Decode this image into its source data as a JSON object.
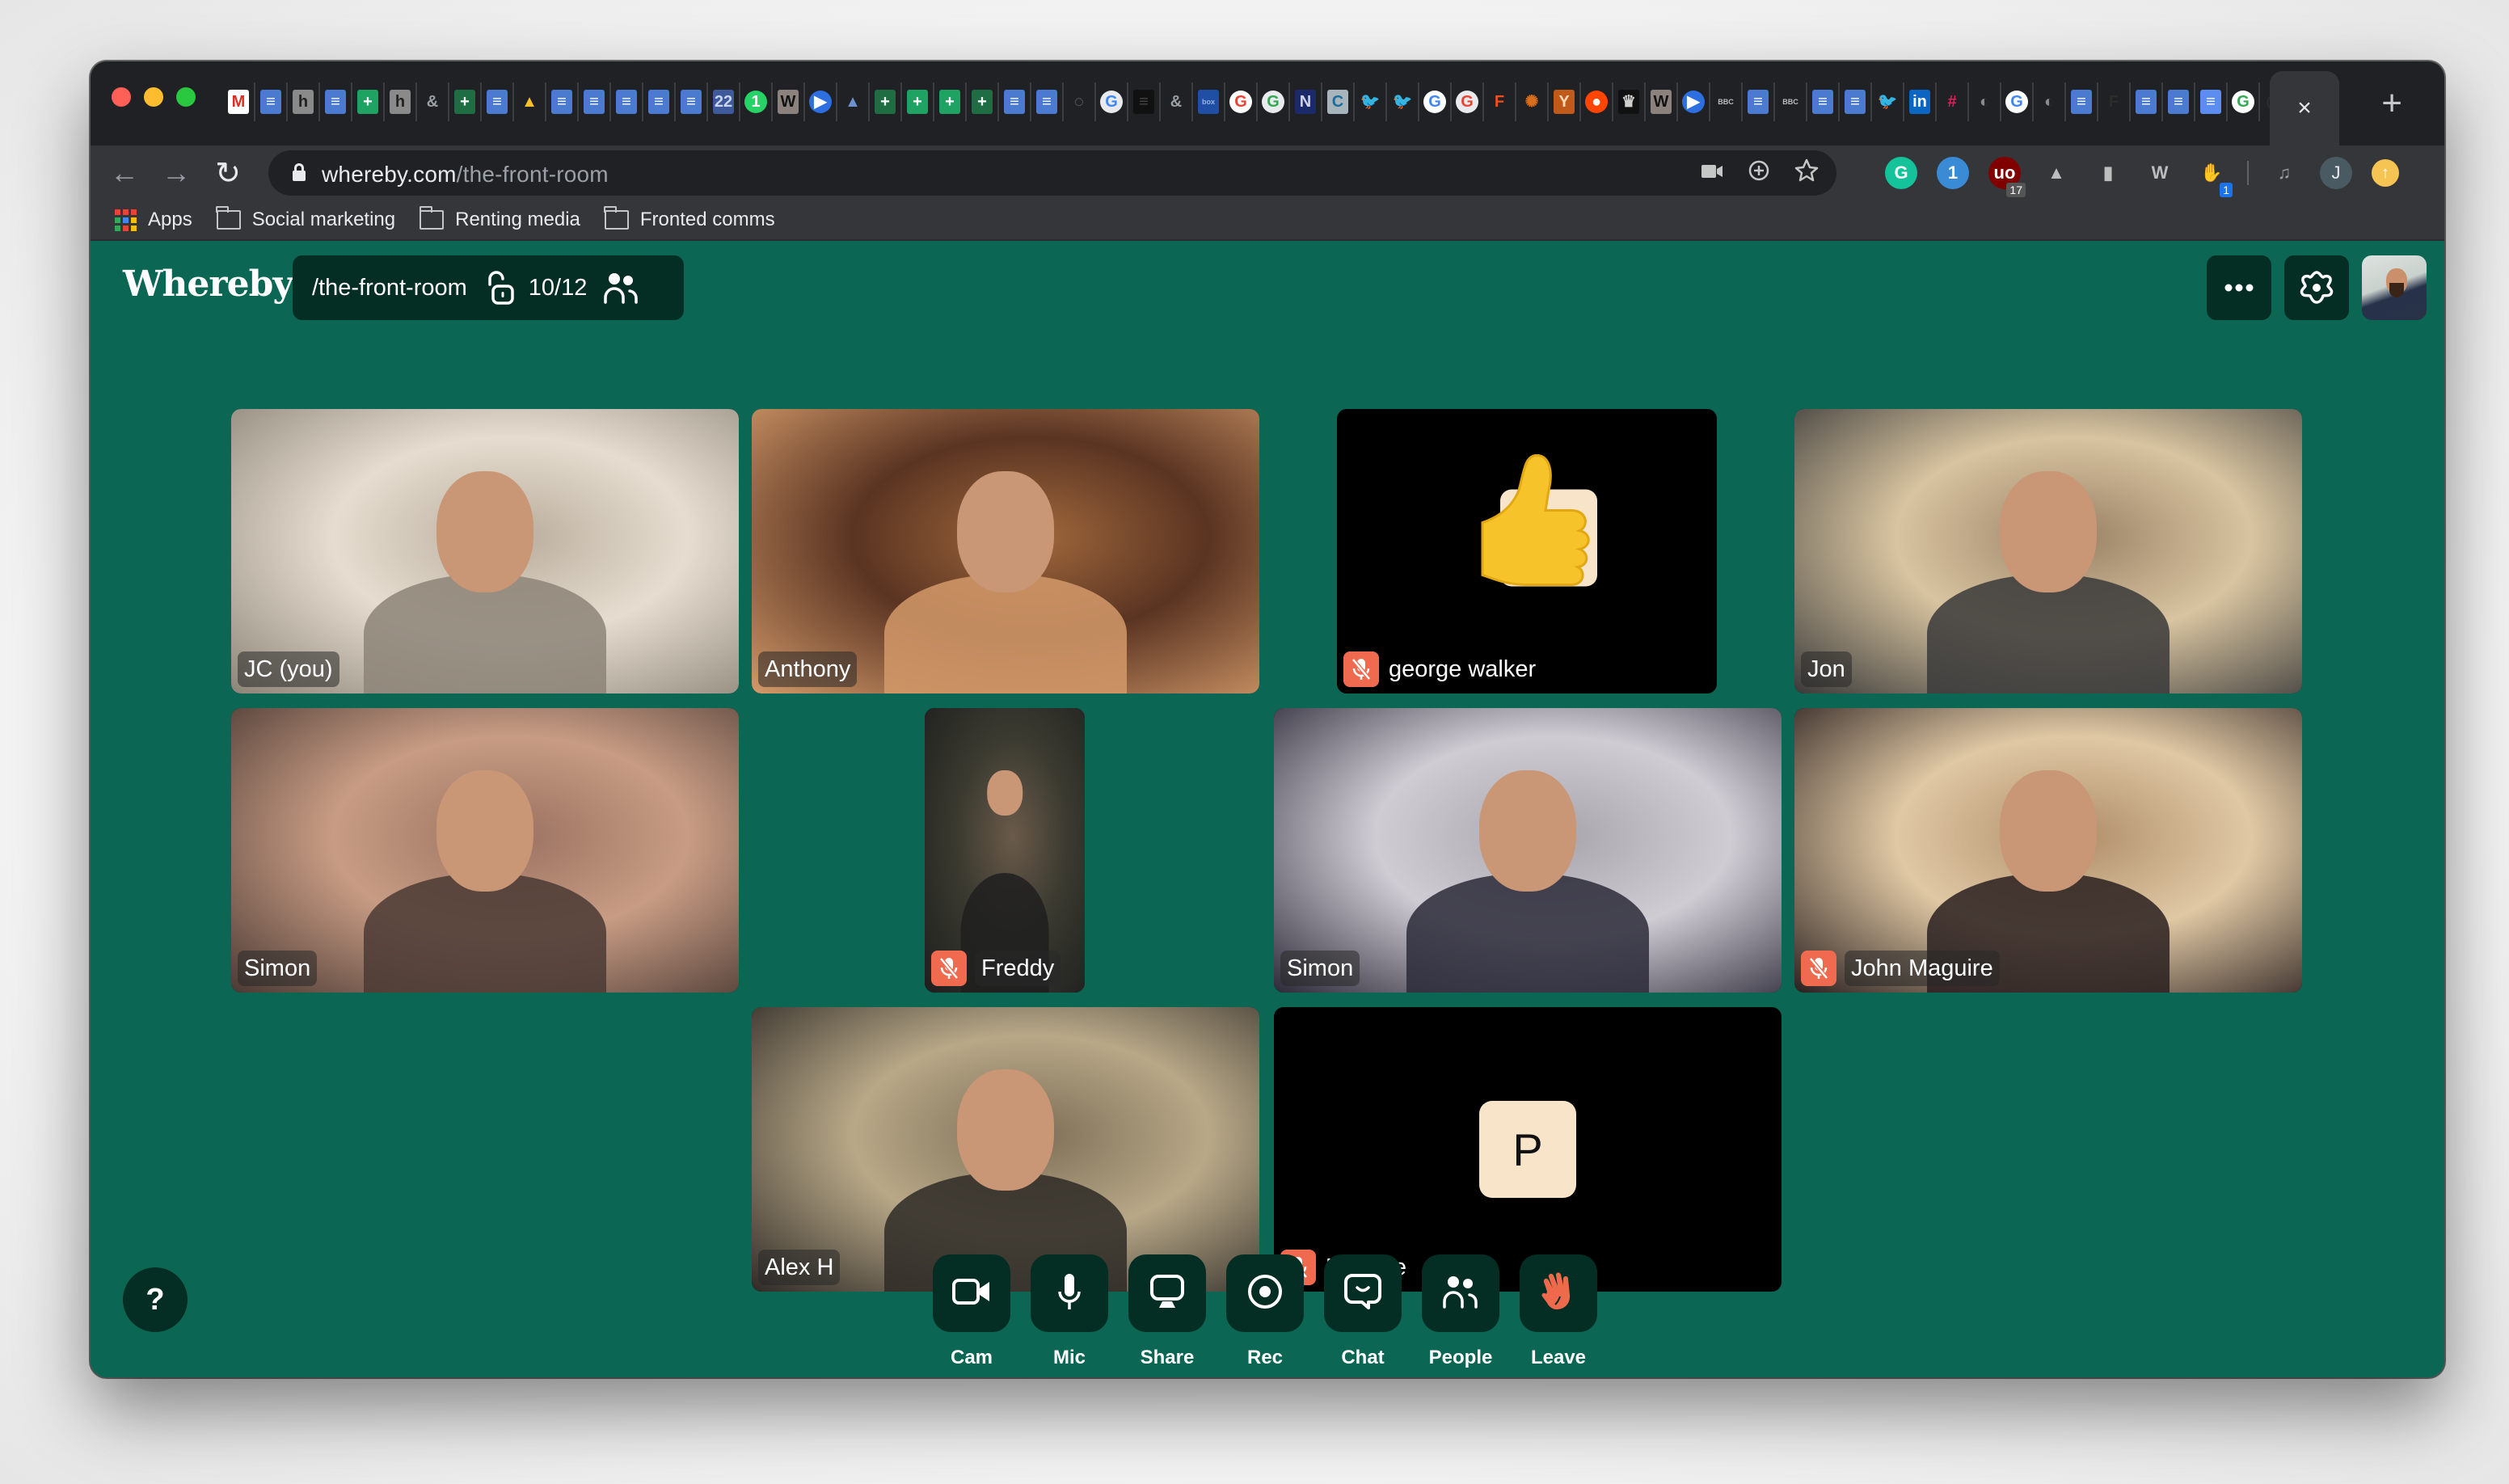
{
  "browser": {
    "window_controls": [
      "close",
      "minimize",
      "maximize"
    ],
    "tabs": [
      {
        "icon": "gmail-icon",
        "glyph": "M",
        "bg": "#ffffff",
        "fg": "#d93025"
      },
      {
        "icon": "google-docs-icon",
        "glyph": "≡",
        "bg": "#4a7bd0",
        "fg": "#ffffff"
      },
      {
        "icon": "h-icon",
        "glyph": "h",
        "bg": "#8a8a8a",
        "fg": "#222222"
      },
      {
        "icon": "google-docs-icon",
        "glyph": "≡",
        "bg": "#4a7bd0",
        "fg": "#ffffff"
      },
      {
        "icon": "google-sheets-icon",
        "glyph": "+",
        "bg": "#1ea362",
        "fg": "#ffffff"
      },
      {
        "icon": "h-icon",
        "glyph": "h",
        "bg": "#8a8a8a",
        "fg": "#222222"
      },
      {
        "icon": "key-icon",
        "glyph": "&",
        "bg": "#202124",
        "fg": "#9aa0a6"
      },
      {
        "icon": "google-sheets-icon",
        "glyph": "+",
        "bg": "#1f6e43",
        "fg": "#ffffff"
      },
      {
        "icon": "google-docs-icon",
        "glyph": "≡",
        "bg": "#4a7bd0",
        "fg": "#ffffff"
      },
      {
        "icon": "google-drive-icon",
        "glyph": "▲",
        "bg": "#202124",
        "fg": "#f6c026"
      },
      {
        "icon": "google-docs-icon",
        "glyph": "≡",
        "bg": "#4a7bd0",
        "fg": "#ffffff"
      },
      {
        "icon": "google-docs-icon",
        "glyph": "≡",
        "bg": "#4a7bd0",
        "fg": "#ffffff"
      },
      {
        "icon": "google-docs-icon",
        "glyph": "≡",
        "bg": "#4a7bd0",
        "fg": "#ffffff"
      },
      {
        "icon": "google-docs-icon",
        "glyph": "≡",
        "bg": "#4a7bd0",
        "fg": "#ffffff"
      },
      {
        "icon": "google-docs-icon",
        "glyph": "≡",
        "bg": "#4a7bd0",
        "fg": "#ffffff"
      },
      {
        "icon": "calendar-icon",
        "glyph": "22",
        "bg": "#3e5a9a",
        "fg": "#c8d4f0"
      },
      {
        "icon": "whatsapp-icon",
        "glyph": "1",
        "bg": "#25d366",
        "fg": "#ffffff",
        "round": true
      },
      {
        "icon": "wikipedia-icon",
        "glyph": "W",
        "bg": "#8c827d",
        "fg": "#111111"
      },
      {
        "icon": "zoom-icon",
        "glyph": "▶",
        "bg": "#2d6ee0",
        "fg": "#ffffff",
        "round": true
      },
      {
        "icon": "google-drive-icon",
        "glyph": "▲",
        "bg": "#202124",
        "fg": "#6e8fd1"
      },
      {
        "icon": "google-sheets-icon",
        "glyph": "+",
        "bg": "#1f6e43",
        "fg": "#ffffff"
      },
      {
        "icon": "google-sheets-icon",
        "glyph": "+",
        "bg": "#1ea362",
        "fg": "#ffffff"
      },
      {
        "icon": "google-sheets-icon",
        "glyph": "+",
        "bg": "#1ea362",
        "fg": "#ffffff"
      },
      {
        "icon": "google-sheets-icon",
        "glyph": "+",
        "bg": "#1f6e43",
        "fg": "#ffffff"
      },
      {
        "icon": "google-docs-icon",
        "glyph": "≡",
        "bg": "#4a7bd0",
        "fg": "#ffffff"
      },
      {
        "icon": "google-docs-icon",
        "glyph": "≡",
        "bg": "#4a7bd0",
        "fg": "#ffffff"
      },
      {
        "icon": "loop-icon",
        "glyph": "◌",
        "bg": "#202124",
        "fg": "#8a8a8a"
      },
      {
        "icon": "google-icon",
        "glyph": "G",
        "bg": "#e8eaed",
        "fg": "#4285f4",
        "round": true
      },
      {
        "icon": "menu-icon",
        "glyph": "≡",
        "bg": "#111111",
        "fg": "#444444"
      },
      {
        "icon": "key-icon",
        "glyph": "&",
        "bg": "#202124",
        "fg": "#9aa0a6"
      },
      {
        "icon": "box-icon",
        "glyph": "box",
        "bg": "#1f4fa5",
        "fg": "#9ab4e8"
      },
      {
        "icon": "google-icon",
        "glyph": "G",
        "bg": "#ffffff",
        "fg": "#ea4335",
        "round": true
      },
      {
        "icon": "google-icon",
        "glyph": "G",
        "bg": "#e8eaed",
        "fg": "#34a853",
        "round": true
      },
      {
        "icon": "notion-icon",
        "glyph": "N",
        "bg": "#1b2a6b",
        "fg": "#d0d4e8"
      },
      {
        "icon": "c-icon",
        "glyph": "C",
        "bg": "#a8b4bc",
        "fg": "#1a6e9a"
      },
      {
        "icon": "twitter-icon",
        "glyph": "🐦",
        "bg": "#202124",
        "fg": "#1d9bf0"
      },
      {
        "icon": "twitter-icon",
        "glyph": "🐦",
        "bg": "#202124",
        "fg": "#1d9bf0"
      },
      {
        "icon": "google-icon",
        "glyph": "G",
        "bg": "#ffffff",
        "fg": "#4285f4",
        "round": true
      },
      {
        "icon": "google-icon",
        "glyph": "G",
        "bg": "#e8eaed",
        "fg": "#ea4335",
        "round": true
      },
      {
        "icon": "figma-icon",
        "glyph": "F",
        "bg": "#202124",
        "fg": "#f24e1e"
      },
      {
        "icon": "sunflower-icon",
        "glyph": "✺",
        "bg": "#202124",
        "fg": "#d86f1c"
      },
      {
        "icon": "y-combinator-icon",
        "glyph": "Y",
        "bg": "#c05a1a",
        "fg": "#ffd8b8"
      },
      {
        "icon": "reddit-icon",
        "glyph": "●",
        "bg": "#ff4500",
        "fg": "#ffffff",
        "round": true
      },
      {
        "icon": "crown-icon",
        "glyph": "♛",
        "bg": "#111111",
        "fg": "#d0d0d0"
      },
      {
        "icon": "wikipedia-icon",
        "glyph": "W",
        "bg": "#8c827d",
        "fg": "#111111"
      },
      {
        "icon": "zoom-icon",
        "glyph": "▶",
        "bg": "#2d6ee0",
        "fg": "#ffffff",
        "round": true
      },
      {
        "icon": "bbc-icon",
        "glyph": "BBC",
        "bg": "#202124",
        "fg": "#bdbdbd"
      },
      {
        "icon": "google-docs-icon",
        "glyph": "≡",
        "bg": "#4a7bd0",
        "fg": "#ffffff"
      },
      {
        "icon": "bbc-icon",
        "glyph": "BBC",
        "bg": "#202124",
        "fg": "#bdbdbd"
      },
      {
        "icon": "google-docs-icon",
        "glyph": "≡",
        "bg": "#4a7bd0",
        "fg": "#ffffff"
      },
      {
        "icon": "google-docs-icon",
        "glyph": "≡",
        "bg": "#4a7bd0",
        "fg": "#ffffff"
      },
      {
        "icon": "twitter-icon",
        "glyph": "🐦",
        "bg": "#202124",
        "fg": "#1d9bf0"
      },
      {
        "icon": "linkedin-icon",
        "glyph": "in",
        "bg": "#0a66c2",
        "fg": "#ffffff"
      },
      {
        "icon": "slack-icon",
        "glyph": "#",
        "bg": "#202124",
        "fg": "#e01e5a"
      },
      {
        "icon": "globe-icon",
        "glyph": "◐",
        "bg": "#202124",
        "fg": "#8a8a8a"
      },
      {
        "icon": "google-icon",
        "glyph": "G",
        "bg": "#ffffff",
        "fg": "#4285f4",
        "round": true
      },
      {
        "icon": "globe-icon",
        "glyph": "◐",
        "bg": "#202124",
        "fg": "#8a8a8a"
      },
      {
        "icon": "google-docs-icon",
        "glyph": "≡",
        "bg": "#4a7bd0",
        "fg": "#ffffff"
      },
      {
        "icon": "f-icon",
        "glyph": "F",
        "bg": "#202124",
        "fg": "#2c2c2c"
      },
      {
        "icon": "google-docs-icon",
        "glyph": "≡",
        "bg": "#4a7bd0",
        "fg": "#ffffff"
      },
      {
        "icon": "google-docs-icon",
        "glyph": "≡",
        "bg": "#4a7bd0",
        "fg": "#ffffff"
      },
      {
        "icon": "google-docs-icon",
        "glyph": "≡",
        "bg": "#5b8ef0",
        "fg": "#ffffff"
      },
      {
        "icon": "google-icon",
        "glyph": "G",
        "bg": "#ffffff",
        "fg": "#34a853",
        "round": true
      },
      {
        "icon": "github-icon",
        "glyph": "◯",
        "bg": "#202124",
        "fg": "#2c2c2c"
      }
    ],
    "active_tab_close": "×",
    "new_tab": "+",
    "nav": {
      "back": "←",
      "forward": "→",
      "reload": "↻"
    },
    "address": {
      "host": "whereby.com",
      "path": "/the-front-room"
    },
    "omnibox_icons": [
      "camera-icon",
      "zoom-in-icon",
      "bookmark-star-icon"
    ],
    "extensions": [
      {
        "icon": "grammarly-icon",
        "glyph": "G",
        "bg": "#15c39a"
      },
      {
        "icon": "password-manager-icon",
        "glyph": "1",
        "bg": "#3a8bd6"
      },
      {
        "icon": "ublock-icon",
        "glyph": "uo",
        "bg": "#800000",
        "badge": "17",
        "badge_bg": "#555555"
      },
      {
        "icon": "drive-icon",
        "glyph": "▲",
        "bg": "#35363a"
      },
      {
        "icon": "battery-icon",
        "glyph": "▮",
        "bg": "#35363a"
      },
      {
        "icon": "wikipedia-icon",
        "glyph": "W",
        "bg": "#35363a"
      },
      {
        "icon": "wave-hand-icon",
        "glyph": "✋",
        "bg": "#35363a",
        "badge": "1",
        "badge_bg": "#1a73e8"
      }
    ],
    "media_control_icon": "♫",
    "profile_initial": "J",
    "update_icon": "↑",
    "bookmarks": [
      {
        "type": "apps",
        "label": "Apps"
      },
      {
        "type": "folder",
        "label": "Social marketing"
      },
      {
        "type": "folder",
        "label": "Renting media"
      },
      {
        "type": "folder",
        "label": "Fronted comms"
      }
    ]
  },
  "app": {
    "brand": "Whereby",
    "brand_color": "#0b6654",
    "dark_color": "#042d23",
    "mute_color": "#f06a50",
    "room": {
      "name": "/the-front-room",
      "occupancy": "10/12",
      "locked": false
    },
    "participants": [
      {
        "name": "JC (you)",
        "muted": false,
        "video": "camera",
        "bg": [
          "#e6ddd0",
          "#b9ad9c",
          "#8d8478"
        ]
      },
      {
        "name": "Anthony",
        "muted": false,
        "video": "camera",
        "bg": [
          "#5a3422",
          "#a0683c",
          "#d39a6a"
        ]
      },
      {
        "name": "george walker",
        "muted": true,
        "video": "emoji",
        "emoji": "👍"
      },
      {
        "name": "Jon",
        "muted": false,
        "video": "camera",
        "bg": [
          "#d8c4a0",
          "#9a8266",
          "#3a3a3a"
        ]
      },
      {
        "name": "Simon",
        "muted": false,
        "video": "camera",
        "bg": [
          "#c89c84",
          "#9a7260",
          "#4a3a34"
        ]
      },
      {
        "name": "Freddy",
        "muted": true,
        "video": "camera",
        "bg": [
          "#3a3a30",
          "#6a5a4a",
          "#1e1e1e"
        ]
      },
      {
        "name": "Simon",
        "muted": false,
        "video": "camera",
        "bg": [
          "#d0ccd4",
          "#a8a4ac",
          "#2c2a38"
        ]
      },
      {
        "name": "John Maguire",
        "muted": true,
        "video": "camera",
        "bg": [
          "#e0c8a4",
          "#b08e6a",
          "#2a2020"
        ]
      },
      {
        "name": "Alex H",
        "muted": false,
        "video": "camera",
        "bg": [
          "#b8a888",
          "#7e6e56",
          "#2e2a26"
        ]
      },
      {
        "name": "Phoebe",
        "muted": true,
        "video": "avatar",
        "initial": "P"
      }
    ],
    "help_label": "?",
    "controls": [
      {
        "id": "cam",
        "label": "Cam"
      },
      {
        "id": "mic",
        "label": "Mic"
      },
      {
        "id": "share",
        "label": "Share"
      },
      {
        "id": "rec",
        "label": "Rec"
      },
      {
        "id": "chat",
        "label": "Chat"
      },
      {
        "id": "people",
        "label": "People"
      },
      {
        "id": "leave",
        "label": "Leave"
      }
    ]
  }
}
